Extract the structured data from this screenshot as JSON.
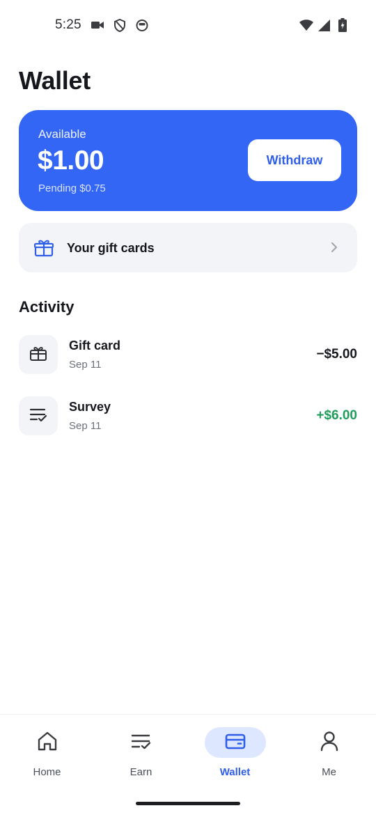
{
  "status_bar": {
    "time": "5:25",
    "left_icons": [
      "video-camera-icon",
      "shield-icon",
      "cat-face-icon"
    ],
    "right_icons": [
      "wifi-icon",
      "cell-signal-icon",
      "battery-charging-icon"
    ]
  },
  "page": {
    "title": "Wallet"
  },
  "balance_card": {
    "label": "Available",
    "amount": "$1.00",
    "pending": "Pending $0.75",
    "withdraw_label": "Withdraw",
    "color": "#3366f5"
  },
  "gift_cards": {
    "label": "Your gift cards",
    "icon": "gift-icon"
  },
  "activity": {
    "heading": "Activity",
    "items": [
      {
        "title": "Gift card",
        "date": "Sep 11",
        "amount": "−$5.00",
        "icon": "gift-icon",
        "type": "debit"
      },
      {
        "title": "Survey",
        "date": "Sep 11",
        "amount": "+$6.00",
        "icon": "checklist-icon",
        "type": "credit"
      }
    ]
  },
  "bottom_nav": {
    "items": [
      {
        "label": "Home",
        "icon": "home-icon",
        "active": false
      },
      {
        "label": "Earn",
        "icon": "checklist-icon",
        "active": false
      },
      {
        "label": "Wallet",
        "icon": "wallet-icon",
        "active": true
      },
      {
        "label": "Me",
        "icon": "person-icon",
        "active": false
      }
    ],
    "accent_color": "#2f5fe8"
  }
}
